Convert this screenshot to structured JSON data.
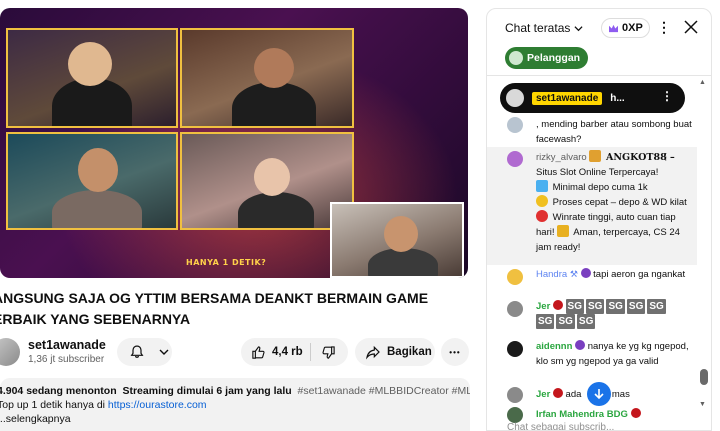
{
  "player": {
    "overlay_text": "HANYA 1 DETIK?"
  },
  "video": {
    "title_line1": "ANGSUNG SAJA OG YTTIM BERSAMA DEANKT BERMAIN GAME",
    "title_line2": "ERBAIK YANG SEBENARNYA",
    "channel_name": "set1awanade",
    "subscribers": "1,36 jt subscriber",
    "like_count": "4,4 rb",
    "share_label": "Bagikan",
    "more_label": "•••"
  },
  "description": {
    "viewers": "4.904 sedang menonton",
    "started": "Streaming dimulai 6 jam yang lalu",
    "hashtags": "#set1awanade #MLBBIDCreator #MLBB",
    "line2_text": "Top up 1 detik hanya di ",
    "line2_link": "https://ourastore.com",
    "line3": "...selengkapnya"
  },
  "chat": {
    "title": "Chat teratas",
    "xp": "0XP",
    "member_button": "Pelanggan",
    "pinned": {
      "name": "set1awanade",
      "message": "h..."
    },
    "messages": [
      {
        "text": ", mending barber atau sombong buat facewash?"
      },
      {
        "user": "rizky_alvaro",
        "badge_text": "ANGKOT88 –",
        "text": "Situs Slot Online Terpercaya!"
      },
      {
        "text": "Minimal depo cuma 1k"
      },
      {
        "text": "Proses cepat – depo & WD kilat"
      },
      {
        "text": "Winrate tinggi, auto cuan tiap hari!"
      },
      {
        "text": "Aman, terpercaya, CS 24 jam ready!"
      },
      {
        "user": "Handra",
        "text": "tapi aeron ga ngankat"
      },
      {
        "user": "Jer",
        "sg": [
          "SG",
          "SG",
          "SG",
          "SG",
          "SG",
          "SG",
          "SG",
          "SG"
        ]
      },
      {
        "user": "aidennn",
        "text": "nanya ke yg kg ngepod, klo sm yg ngepod ya ga valid"
      },
      {
        "user": "Jer",
        "text": "ada ",
        "tail": "b2f mas"
      },
      {
        "user": "Irfan Mahendra BDG"
      }
    ],
    "input_placeholder": "Chat sebagai subscrib..."
  },
  "colors": {
    "accent_blue": "#065fd4",
    "member_green": "#2e7d32",
    "pinned_yellow": "#ffd600"
  }
}
